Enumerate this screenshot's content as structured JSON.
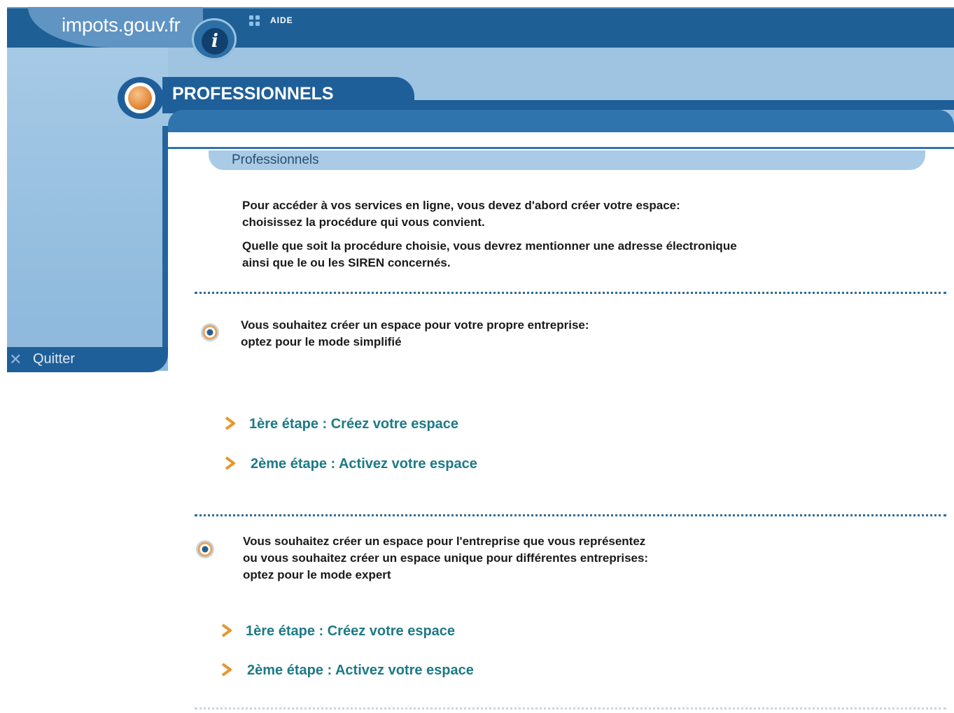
{
  "header": {
    "logo": "impots.gouv.fr",
    "aide": "AIDE",
    "section_title": "PROFESSIONNELS"
  },
  "sidebar": {
    "quit_label": "Quitter"
  },
  "panel": {
    "title": "Professionnels",
    "intro_line1": "Pour accéder à vos services en ligne, vous devez d'abord créer votre espace:",
    "intro_line2": "choisissez la procédure qui vous convient.",
    "intro_line3": "Quelle que soit la procédure choisie, vous devrez mentionner une adresse électronique",
    "intro_line4": "ainsi que le ou les SIREN concernés."
  },
  "sections": [
    {
      "line1": "Vous souhaitez créer un espace pour votre propre entreprise:",
      "line2": "optez pour le mode simplifié",
      "step1": "1ère étape : Créez votre espace",
      "step2": "2ème étape : Activez votre espace"
    },
    {
      "line1": "Vous souhaitez créer un espace pour l'entreprise que vous représentez",
      "line2": "ou vous souhaitez créer un espace unique pour différentes entreprises:",
      "line3": "optez pour le mode expert",
      "step1": "1ère étape : Créez votre espace",
      "step2": "2ème étape : Activez votre espace"
    }
  ],
  "colors": {
    "header_blue": "#1e5f96",
    "light_blue": "#9ec4e2",
    "link_teal": "#1d7a86",
    "chevron_orange": "#e8962e"
  }
}
